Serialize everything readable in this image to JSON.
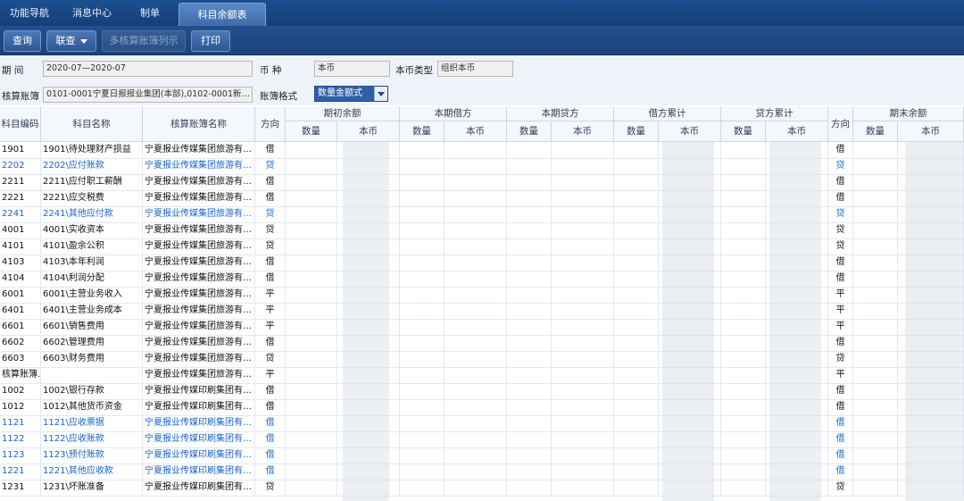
{
  "tabs": [
    {
      "label": "功能导航"
    },
    {
      "label": "消息中心"
    },
    {
      "label": "制单"
    },
    {
      "label": "科目余额表",
      "active": true
    }
  ],
  "toolbar": {
    "query": "查询",
    "link_query": "联查",
    "multi_book": "多核算账簿列示",
    "print": "打印"
  },
  "filters": {
    "period_label": "期 间",
    "period_value": "2020-07—2020-07",
    "currency_label": "币 种",
    "currency_value": "本币",
    "local_currency_type_label": "本币类型",
    "local_currency_type_value": "组织本币",
    "book_label": "核算账簿",
    "book_value": "0101-0001宁夏日报报业集团(本部),0102-0001新…",
    "format_label": "账簿格式",
    "format_value": "数量金额式"
  },
  "table": {
    "headers": {
      "code": "科目编码",
      "name": "科目名称",
      "book": "核算账簿名称",
      "dir": "方向",
      "opening": "期初余额",
      "debit": "本期借方",
      "credit": "本期贷方",
      "debit_acc": "借方累计",
      "credit_acc": "贷方累计",
      "dir2": "方向",
      "closing": "期末余额",
      "qty": "数量",
      "amount": "本币"
    },
    "rows": [
      {
        "code": "1901",
        "name": "1901\\待处理财产损益",
        "book": "宁夏报业传媒集团旅游有…",
        "dir": "借",
        "dir2": "借",
        "blue": false
      },
      {
        "code": "2202",
        "name": "2202\\应付账款",
        "book": "宁夏报业传媒集团旅游有…",
        "dir": "贷",
        "dir2": "贷",
        "blue": true
      },
      {
        "code": "2211",
        "name": "2211\\应付职工薪酬",
        "book": "宁夏报业传媒集团旅游有…",
        "dir": "借",
        "dir2": "借",
        "blue": false
      },
      {
        "code": "2221",
        "name": "2221\\应交税费",
        "book": "宁夏报业传媒集团旅游有…",
        "dir": "借",
        "dir2": "借",
        "blue": false
      },
      {
        "code": "2241",
        "name": "2241\\其他应付款",
        "book": "宁夏报业传媒集团旅游有…",
        "dir": "贷",
        "dir2": "贷",
        "blue": true
      },
      {
        "code": "4001",
        "name": "4001\\实收资本",
        "book": "宁夏报业传媒集团旅游有…",
        "dir": "贷",
        "dir2": "贷",
        "blue": false
      },
      {
        "code": "4101",
        "name": "4101\\盈余公积",
        "book": "宁夏报业传媒集团旅游有…",
        "dir": "贷",
        "dir2": "贷",
        "blue": false
      },
      {
        "code": "4103",
        "name": "4103\\本年利润",
        "book": "宁夏报业传媒集团旅游有…",
        "dir": "借",
        "dir2": "借",
        "blue": false
      },
      {
        "code": "4104",
        "name": "4104\\利润分配",
        "book": "宁夏报业传媒集团旅游有…",
        "dir": "借",
        "dir2": "借",
        "blue": false
      },
      {
        "code": "6001",
        "name": "6001\\主营业务收入",
        "book": "宁夏报业传媒集团旅游有…",
        "dir": "平",
        "dir2": "平",
        "blue": false
      },
      {
        "code": "6401",
        "name": "6401\\主营业务成本",
        "book": "宁夏报业传媒集团旅游有…",
        "dir": "平",
        "dir2": "平",
        "blue": false
      },
      {
        "code": "6601",
        "name": "6601\\销售费用",
        "book": "宁夏报业传媒集团旅游有…",
        "dir": "平",
        "dir2": "平",
        "blue": false
      },
      {
        "code": "6602",
        "name": "6602\\管理费用",
        "book": "宁夏报业传媒集团旅游有…",
        "dir": "借",
        "dir2": "借",
        "blue": false
      },
      {
        "code": "6603",
        "name": "6603\\财务费用",
        "book": "宁夏报业传媒集团旅游有…",
        "dir": "贷",
        "dir2": "贷",
        "blue": false
      },
      {
        "code": "核算账簿…",
        "name": "",
        "book": "宁夏报业传媒集团旅游有…",
        "dir": "平",
        "dir2": "平",
        "blue": false
      },
      {
        "code": "1002",
        "name": "1002\\银行存款",
        "book": "宁夏报业传媒印刷集团有…",
        "dir": "借",
        "dir2": "借",
        "blue": false
      },
      {
        "code": "1012",
        "name": "1012\\其他货币资金",
        "book": "宁夏报业传媒印刷集团有…",
        "dir": "借",
        "dir2": "借",
        "blue": false
      },
      {
        "code": "1121",
        "name": "1121\\应收票据",
        "book": "宁夏报业传媒印刷集团有…",
        "dir": "借",
        "dir2": "借",
        "blue": true
      },
      {
        "code": "1122",
        "name": "1122\\应收账款",
        "book": "宁夏报业传媒印刷集团有…",
        "dir": "借",
        "dir2": "借",
        "blue": true
      },
      {
        "code": "1123",
        "name": "1123\\预付账款",
        "book": "宁夏报业传媒印刷集团有…",
        "dir": "借",
        "dir2": "借",
        "blue": true
      },
      {
        "code": "1221",
        "name": "1221\\其他应收款",
        "book": "宁夏报业传媒印刷集团有…",
        "dir": "借",
        "dir2": "借",
        "blue": true
      },
      {
        "code": "1231",
        "name": "1231\\坏账准备",
        "book": "宁夏报业传媒印刷集团有…",
        "dir": "贷",
        "dir2": "贷",
        "blue": false
      }
    ]
  }
}
